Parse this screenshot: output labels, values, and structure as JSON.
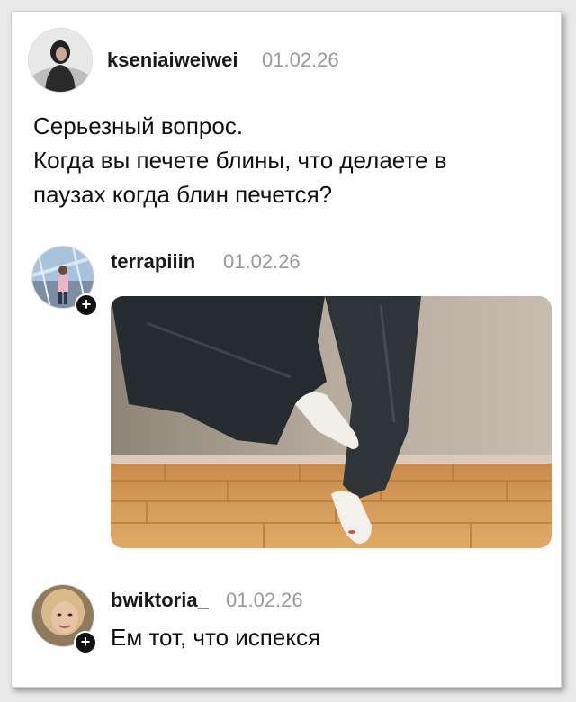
{
  "post": {
    "username": "kseniaiweiwei",
    "date": "01.02.26",
    "lines": [
      "Серьезный вопрос.",
      "Когда вы печете блины, что делаете в",
      "паузах когда блин печется?"
    ]
  },
  "reply1": {
    "username": "terrapiiin",
    "date": "01.02.26",
    "follow_icon": "plus-icon",
    "photo": "photo of a person in dark jeans standing on one leg on a wooden floor"
  },
  "reply2": {
    "username": "bwiktoria_",
    "date": "01.02.26",
    "text": "Ем тот, что испекся",
    "follow_icon": "plus-icon"
  }
}
